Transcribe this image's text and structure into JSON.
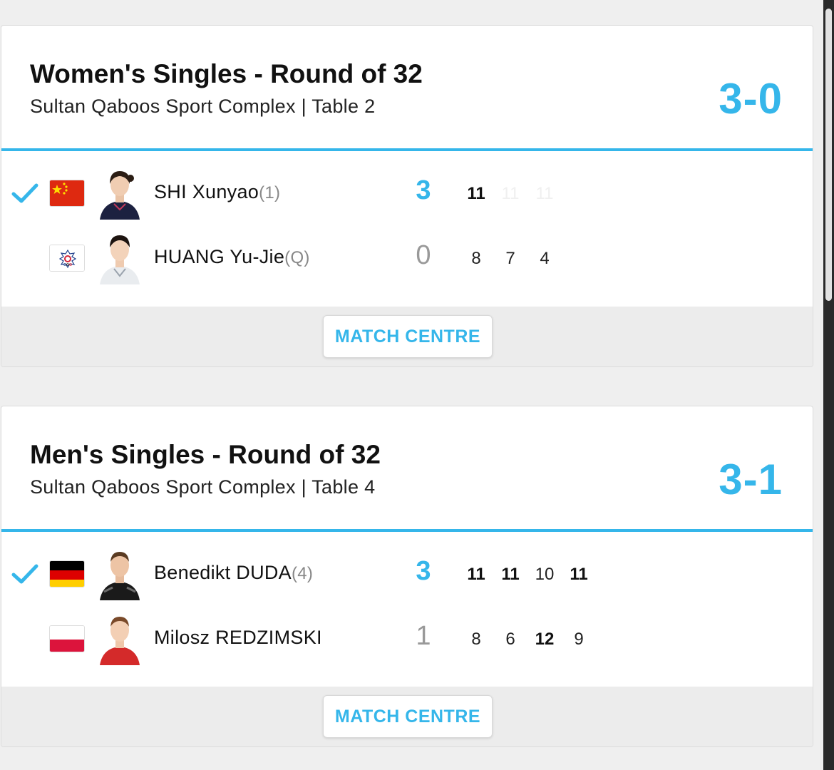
{
  "colors": {
    "accent": "#35b6ea",
    "winner_check": "#35b6ea"
  },
  "matches": [
    {
      "title": "Women's Singles - Round of 32",
      "venue": "Sultan Qaboos Sport Complex | Table 2",
      "score": "3-0",
      "button_label": "MATCH CENTRE",
      "players": [
        {
          "name": "SHI Xunyao",
          "seed": "(1)",
          "flag_icon": "china-flag-icon",
          "games": "3",
          "winner": true,
          "sets": [
            "11",
            "11",
            "11"
          ]
        },
        {
          "name": "HUANG Yu-Jie",
          "seed": "(Q)",
          "flag_icon": "chinese-taipei-flag-icon",
          "games": "0",
          "winner": false,
          "sets": [
            "8",
            "7",
            "4"
          ]
        }
      ]
    },
    {
      "title": "Men's Singles - Round of 32",
      "venue": "Sultan Qaboos Sport Complex | Table 4",
      "score": "3-1",
      "button_label": "MATCH CENTRE",
      "players": [
        {
          "name": "Benedikt DUDA",
          "seed": "(4)",
          "flag_icon": "germany-flag-icon",
          "games": "3",
          "winner": true,
          "sets": [
            "11",
            "11",
            "10",
            "11"
          ]
        },
        {
          "name": "Milosz REDZIMSKI",
          "seed": "",
          "flag_icon": "poland-flag-icon",
          "games": "1",
          "winner": false,
          "sets": [
            "8",
            "6",
            "12",
            "9"
          ]
        }
      ]
    }
  ]
}
